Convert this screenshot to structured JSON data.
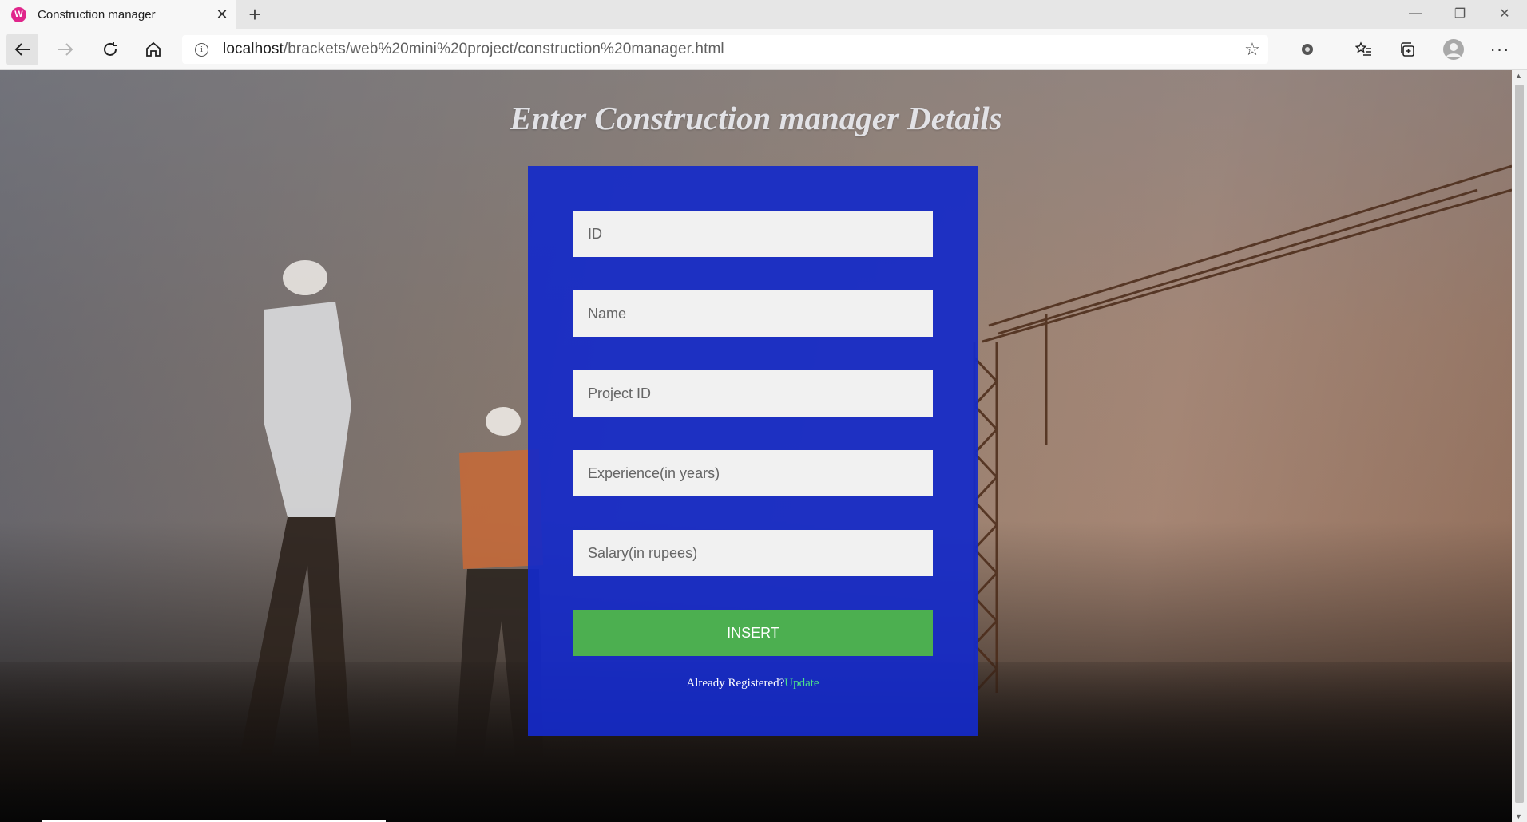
{
  "browser": {
    "tab_title": "Construction manager",
    "tab_favicon_text": "W",
    "url_host": "localhost",
    "url_path": "/brackets/web%20mini%20project/construction%20manager.html"
  },
  "page": {
    "heading": "Enter Construction manager Details",
    "fields": [
      {
        "placeholder": "ID"
      },
      {
        "placeholder": "Name"
      },
      {
        "placeholder": "Project ID"
      },
      {
        "placeholder": "Experience(in years)"
      },
      {
        "placeholder": "Salary(in rupees)"
      }
    ],
    "insert_label": "INSERT",
    "registered_text": "Already Registered?",
    "update_link": "Update"
  },
  "colors": {
    "card": "#142ac8",
    "insert_button": "#4caf50",
    "update_link": "#4ee28a"
  }
}
